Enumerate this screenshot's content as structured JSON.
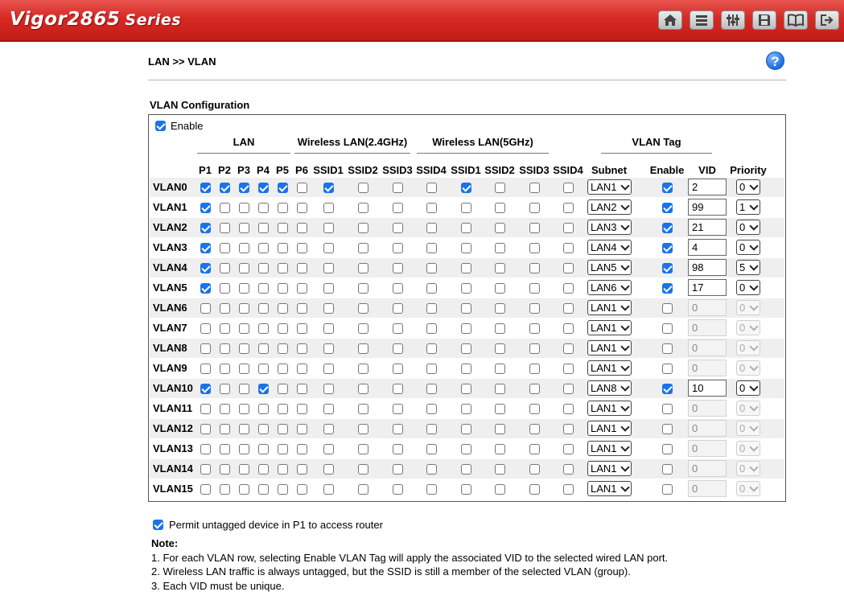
{
  "header": {
    "brand": "Vigor2865",
    "series": "Series",
    "icons": [
      "home-icon",
      "menu-icon",
      "settings-sliders-icon",
      "save-icon",
      "book-icon",
      "logout-icon"
    ]
  },
  "breadcrumb": "LAN >> VLAN",
  "help_label": "?",
  "section_title": "VLAN Configuration",
  "enable_label": "Enable",
  "enable_checked": true,
  "groups": {
    "lan": "LAN",
    "wlan24": "Wireless LAN(2.4GHz)",
    "wlan5": "Wireless LAN(5GHz)",
    "vlantag": "VLAN Tag"
  },
  "columns": [
    "P1",
    "P2",
    "P3",
    "P4",
    "P5",
    "P6",
    "SSID1",
    "SSID2",
    "SSID3",
    "SSID4",
    "SSID1",
    "SSID2",
    "SSID3",
    "SSID4",
    "Subnet",
    "Enable",
    "VID",
    "Priority"
  ],
  "rows": [
    {
      "name": "VLAN0",
      "checks": [
        1,
        1,
        1,
        1,
        1,
        0,
        1,
        0,
        0,
        0,
        1,
        0,
        0,
        0
      ],
      "subnet": "LAN1",
      "tag": true,
      "vid": "2",
      "priority": "0"
    },
    {
      "name": "VLAN1",
      "checks": [
        1,
        0,
        0,
        0,
        0,
        0,
        0,
        0,
        0,
        0,
        0,
        0,
        0,
        0
      ],
      "subnet": "LAN2",
      "tag": true,
      "vid": "99",
      "priority": "1"
    },
    {
      "name": "VLAN2",
      "checks": [
        1,
        0,
        0,
        0,
        0,
        0,
        0,
        0,
        0,
        0,
        0,
        0,
        0,
        0
      ],
      "subnet": "LAN3",
      "tag": true,
      "vid": "21",
      "priority": "0"
    },
    {
      "name": "VLAN3",
      "checks": [
        1,
        0,
        0,
        0,
        0,
        0,
        0,
        0,
        0,
        0,
        0,
        0,
        0,
        0
      ],
      "subnet": "LAN4",
      "tag": true,
      "vid": "4",
      "priority": "0"
    },
    {
      "name": "VLAN4",
      "checks": [
        1,
        0,
        0,
        0,
        0,
        0,
        0,
        0,
        0,
        0,
        0,
        0,
        0,
        0
      ],
      "subnet": "LAN5",
      "tag": true,
      "vid": "98",
      "priority": "5"
    },
    {
      "name": "VLAN5",
      "checks": [
        1,
        0,
        0,
        0,
        0,
        0,
        0,
        0,
        0,
        0,
        0,
        0,
        0,
        0
      ],
      "subnet": "LAN6",
      "tag": true,
      "vid": "17",
      "priority": "0"
    },
    {
      "name": "VLAN6",
      "checks": [
        0,
        0,
        0,
        0,
        0,
        0,
        0,
        0,
        0,
        0,
        0,
        0,
        0,
        0
      ],
      "subnet": "LAN1",
      "tag": false,
      "vid": "0",
      "priority": "0"
    },
    {
      "name": "VLAN7",
      "checks": [
        0,
        0,
        0,
        0,
        0,
        0,
        0,
        0,
        0,
        0,
        0,
        0,
        0,
        0
      ],
      "subnet": "LAN1",
      "tag": false,
      "vid": "0",
      "priority": "0"
    },
    {
      "name": "VLAN8",
      "checks": [
        0,
        0,
        0,
        0,
        0,
        0,
        0,
        0,
        0,
        0,
        0,
        0,
        0,
        0
      ],
      "subnet": "LAN1",
      "tag": false,
      "vid": "0",
      "priority": "0"
    },
    {
      "name": "VLAN9",
      "checks": [
        0,
        0,
        0,
        0,
        0,
        0,
        0,
        0,
        0,
        0,
        0,
        0,
        0,
        0
      ],
      "subnet": "LAN1",
      "tag": false,
      "vid": "0",
      "priority": "0"
    },
    {
      "name": "VLAN10",
      "checks": [
        1,
        0,
        0,
        1,
        0,
        0,
        0,
        0,
        0,
        0,
        0,
        0,
        0,
        0
      ],
      "subnet": "LAN8",
      "tag": true,
      "vid": "10",
      "priority": "0"
    },
    {
      "name": "VLAN11",
      "checks": [
        0,
        0,
        0,
        0,
        0,
        0,
        0,
        0,
        0,
        0,
        0,
        0,
        0,
        0
      ],
      "subnet": "LAN1",
      "tag": false,
      "vid": "0",
      "priority": "0"
    },
    {
      "name": "VLAN12",
      "checks": [
        0,
        0,
        0,
        0,
        0,
        0,
        0,
        0,
        0,
        0,
        0,
        0,
        0,
        0
      ],
      "subnet": "LAN1",
      "tag": false,
      "vid": "0",
      "priority": "0"
    },
    {
      "name": "VLAN13",
      "checks": [
        0,
        0,
        0,
        0,
        0,
        0,
        0,
        0,
        0,
        0,
        0,
        0,
        0,
        0
      ],
      "subnet": "LAN1",
      "tag": false,
      "vid": "0",
      "priority": "0"
    },
    {
      "name": "VLAN14",
      "checks": [
        0,
        0,
        0,
        0,
        0,
        0,
        0,
        0,
        0,
        0,
        0,
        0,
        0,
        0
      ],
      "subnet": "LAN1",
      "tag": false,
      "vid": "0",
      "priority": "0"
    },
    {
      "name": "VLAN15",
      "checks": [
        0,
        0,
        0,
        0,
        0,
        0,
        0,
        0,
        0,
        0,
        0,
        0,
        0,
        0
      ],
      "subnet": "LAN1",
      "tag": false,
      "vid": "0",
      "priority": "0"
    }
  ],
  "permit": {
    "checked": true,
    "label": "Permit untagged device in P1 to access router"
  },
  "note": {
    "title": "Note:",
    "lines": [
      "1. For each VLAN row, selecting Enable VLAN Tag will apply the associated VID to the selected wired LAN port.",
      "2. Wireless LAN traffic is always untagged, but the SSID is still a member of the selected VLAN (group).",
      "3. Each VID must be unique."
    ]
  }
}
